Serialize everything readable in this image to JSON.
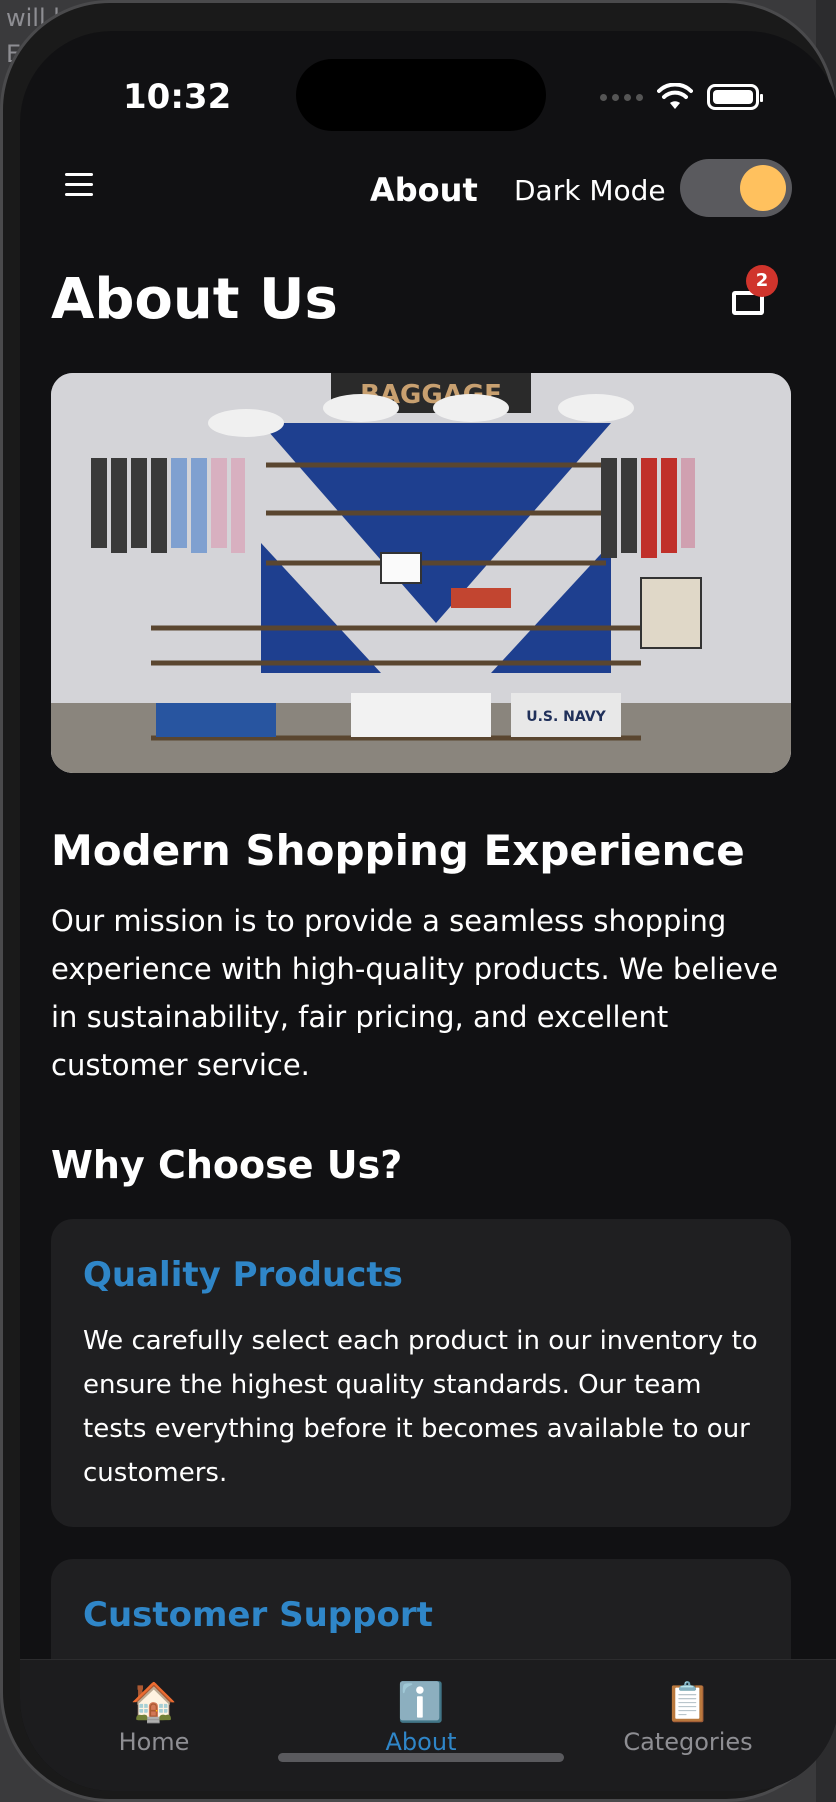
{
  "background": {
    "line1": "will he",
    "line2": "E"
  },
  "status_bar": {
    "time": "10:32"
  },
  "header": {
    "title": "About",
    "dark_mode_label": "Dark Mode",
    "dark_mode_on": true,
    "cart_count": "2"
  },
  "page": {
    "title": "About Us"
  },
  "hero": {
    "sign_text": "BAGGAGE",
    "shirt_text": "U.S. NAVY"
  },
  "intro": {
    "heading": "Modern Shopping Experience",
    "body": "Our mission is to provide a seamless shopping experience with high-quality products. We believe in sustainability, fair pricing, and excellent customer service."
  },
  "why": {
    "heading": "Why Choose Us?",
    "cards": [
      {
        "title": "Quality Products",
        "body": "We carefully select each product in our inventory to ensure the highest quality standards. Our team tests everything before it becomes available to our customers."
      },
      {
        "title": "Customer Support",
        "body": ""
      }
    ]
  },
  "tabs": [
    {
      "label": "Home",
      "icon": "house-icon"
    },
    {
      "label": "About",
      "icon": "info-icon",
      "active": true
    },
    {
      "label": "Categories",
      "icon": "clipboard-icon"
    }
  ],
  "colors": {
    "accent": "#2f86c8",
    "toggle_knob": "#ffc15e",
    "badge": "#d0342c",
    "background": "#111113"
  }
}
